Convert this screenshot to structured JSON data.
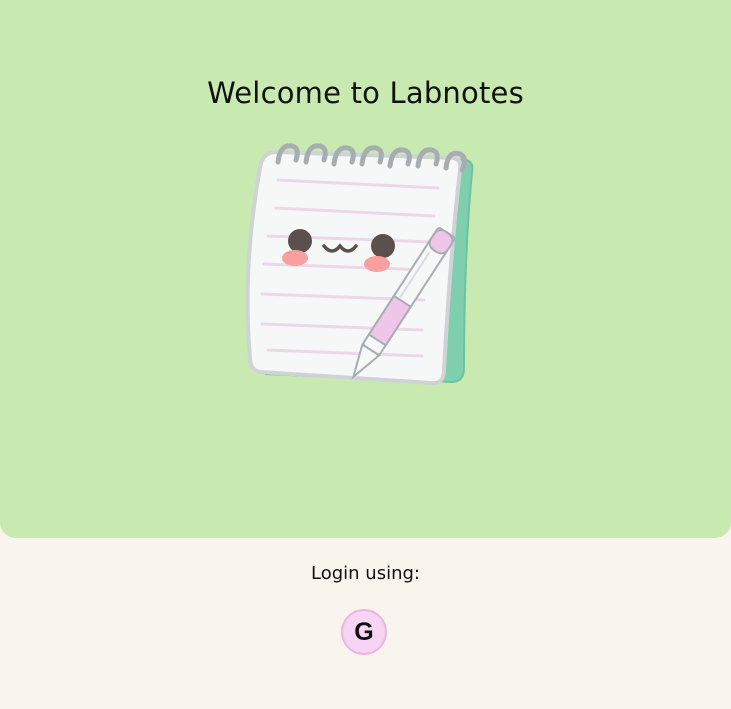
{
  "hero": {
    "title": "Welcome to Labnotes",
    "illustration": "kawaii-notepad-with-pencil"
  },
  "login": {
    "label": "Login using:",
    "providers": [
      {
        "name": "google",
        "glyph": "G",
        "icon": "google-icon"
      }
    ]
  },
  "colors": {
    "hero_bg": "#c8eab1",
    "page_bg": "#faf4ee",
    "button_bg": "#f8d4f4",
    "button_border": "#e8b6e4"
  }
}
